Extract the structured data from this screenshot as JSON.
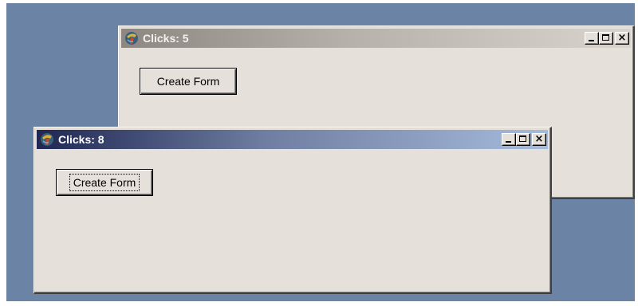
{
  "windows": {
    "back": {
      "title": "Clicks: 5",
      "button_label": "Create Form",
      "active": false
    },
    "front": {
      "title": "Clicks: 8",
      "button_label": "Create Form",
      "active": true
    }
  },
  "caption_buttons": {
    "minimize_glyph": "minimize-icon",
    "maximize_glyph": "maximize-icon",
    "close_glyph": "×"
  },
  "icons": {
    "app": "delphi-app-icon"
  },
  "colors": {
    "desktop": "#6b83a5",
    "window_face": "#e6e0da",
    "active_title_start": "#1f2752",
    "active_title_end": "#a6bbdb",
    "inactive_title_start": "#8d8782",
    "inactive_title_end": "#d8d3cd"
  }
}
